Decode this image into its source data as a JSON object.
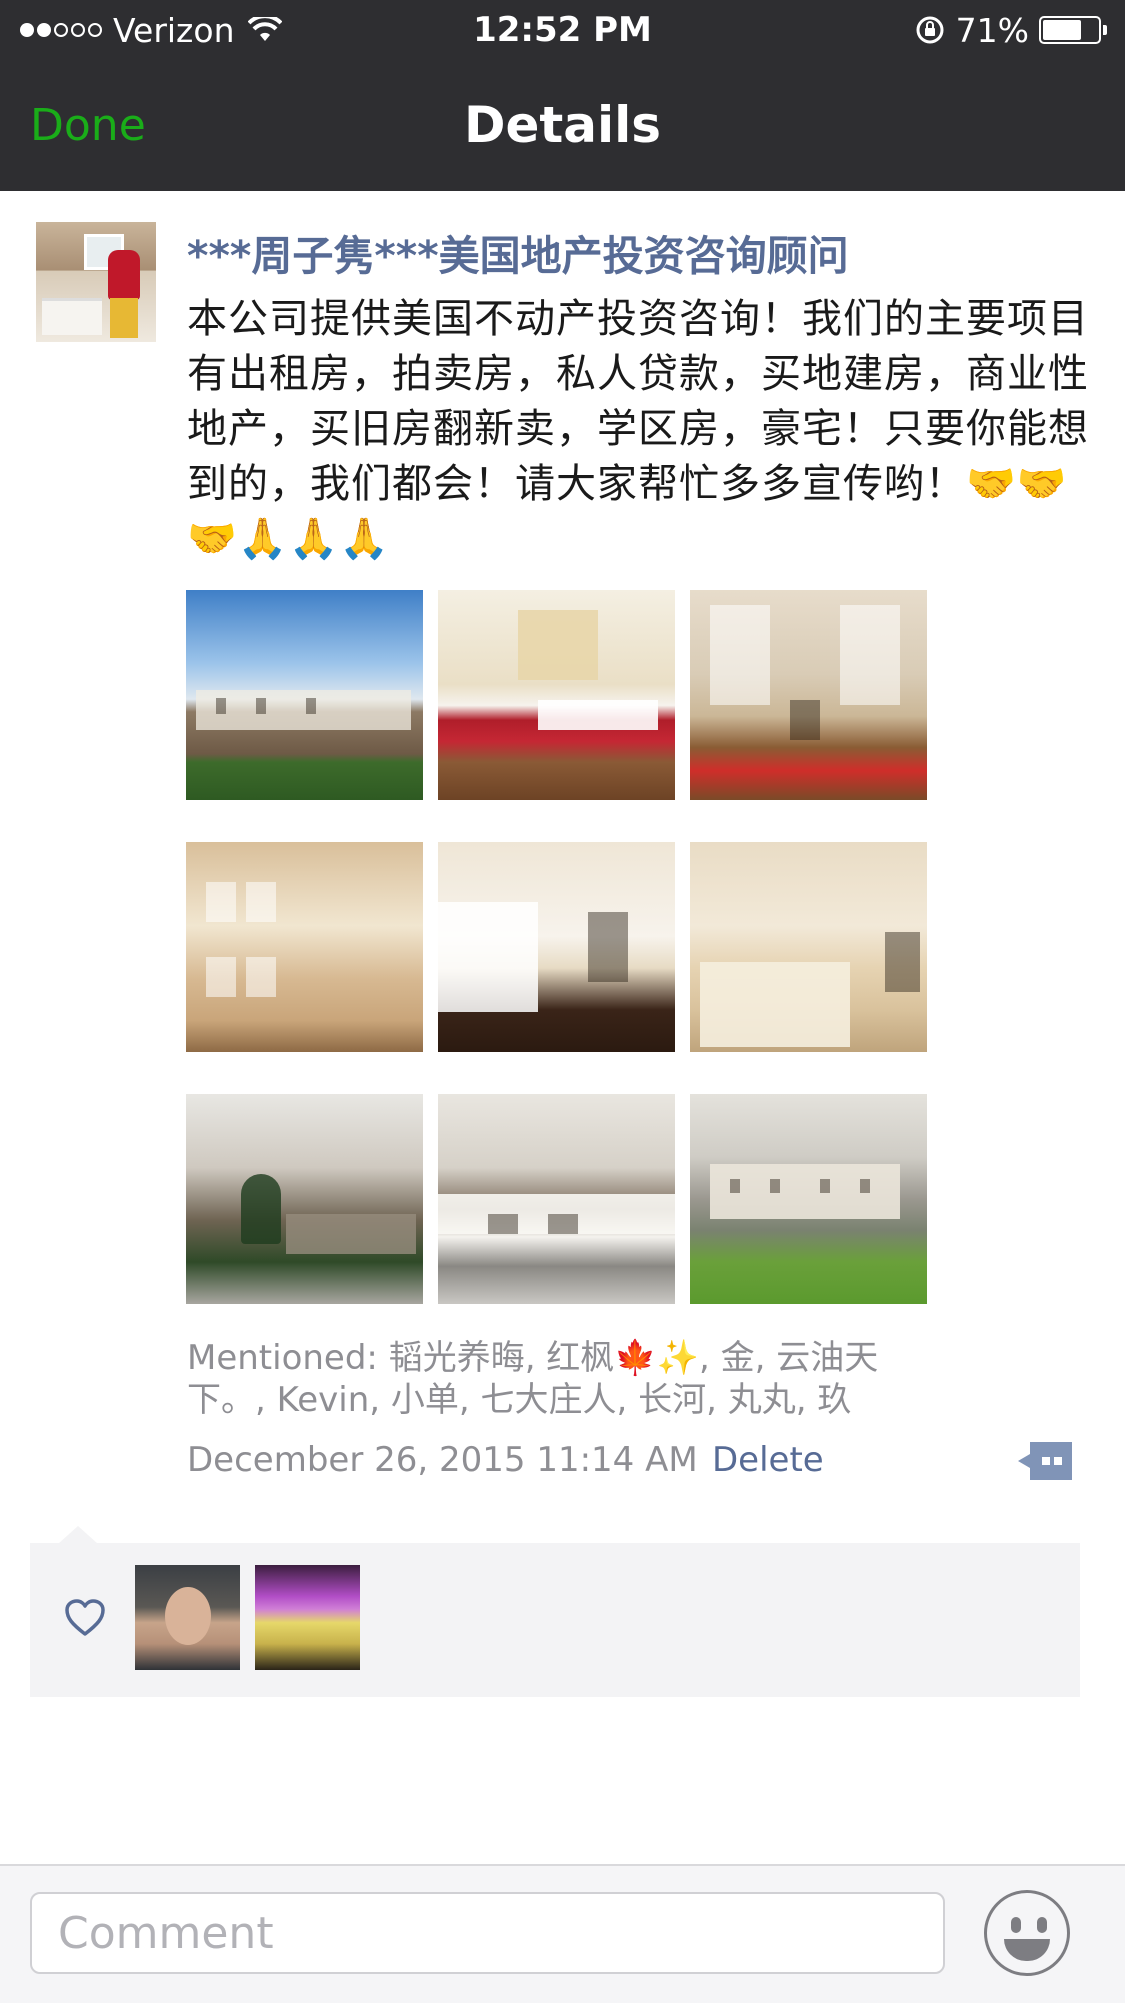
{
  "status_bar": {
    "carrier": "Verizon",
    "time": "12:52 PM",
    "battery_percent": "71%",
    "battery_level": 0.71,
    "signal_full_dots": 2,
    "signal_total_dots": 5
  },
  "nav": {
    "done_label": "Done",
    "title": "Details",
    "done_color": "#1aad19"
  },
  "post": {
    "author": "***周子隽***美国地产投资咨询顾问",
    "text": "本公司提供美国不动产投资咨询！我们的主要项目有出租房，拍卖房，私人贷款，买地建房，商业性地产，买旧房翻新卖，学区房，豪宅！只要你能想到的，我们都会！请大家帮忙多多宣传哟！🤝🤝🤝🙏🙏🙏",
    "photos": [
      {
        "name": "photo-house-exterior"
      },
      {
        "name": "photo-kitchen"
      },
      {
        "name": "photo-dining-room"
      },
      {
        "name": "photo-sunroom"
      },
      {
        "name": "photo-foyer-staircase"
      },
      {
        "name": "photo-bathroom"
      },
      {
        "name": "photo-backyard-wall"
      },
      {
        "name": "photo-garage"
      },
      {
        "name": "photo-house-lawn"
      }
    ],
    "mentioned": "Mentioned: 韬光养晦, 红枫🍁✨, 金, 云油天下。, Kevin, 小单, 七大庄人, 长河, 丸丸, 玖",
    "timestamp": "December 26, 2015 11:14 AM",
    "delete_label": "Delete"
  },
  "likes": {
    "icon": "heart-outline-icon",
    "users": [
      {
        "name": "liker-avatar-1"
      },
      {
        "name": "liker-avatar-2"
      }
    ]
  },
  "comment_bar": {
    "placeholder": "Comment",
    "emoji_icon": "smiley-icon"
  },
  "colors": {
    "link_blue": "#576b95",
    "bar_dark": "#2e2e31",
    "meta_gray": "#8e8e93"
  }
}
